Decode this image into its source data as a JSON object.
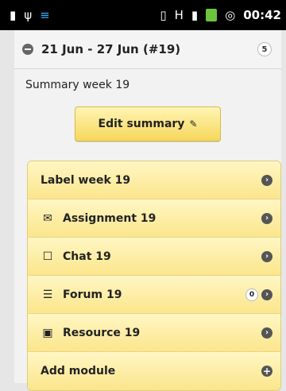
{
  "status_bar": {
    "time": "00:42",
    "icons": [
      "chart-icon",
      "usb-icon",
      "wifi-icon",
      "vibrate-icon",
      "signal-icon",
      "bars-icon",
      "battery-icon",
      "alarm-icon"
    ]
  },
  "week": {
    "title": "21 Jun - 27 Jun (#19)",
    "count": "5",
    "summary_label": "Summary week 19",
    "edit_label": "Edit summary"
  },
  "modules": [
    {
      "label": "Label week 19"
    },
    {
      "label": "Assignment 19",
      "icon": "assignment-icon"
    },
    {
      "label": "Chat 19",
      "icon": "chat-icon"
    },
    {
      "label": "Forum 19",
      "icon": "forum-icon",
      "count": "0"
    },
    {
      "label": "Resource 19",
      "icon": "resource-icon"
    },
    {
      "label": "Add module"
    }
  ],
  "colors": {
    "module_bg": "#fbe68c",
    "button_bg": "#f6d75a",
    "statusbar": "#000000"
  }
}
